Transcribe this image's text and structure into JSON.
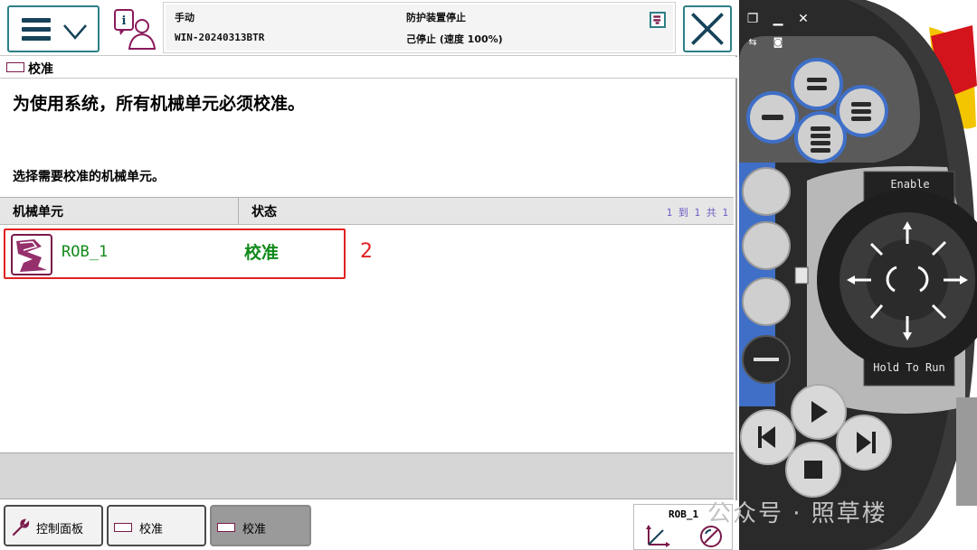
{
  "status": {
    "mode": "手动",
    "hostname": "WIN-20240313BTR",
    "guard_state": "防护装置停止",
    "run_state": "己停止 (速度 100%)"
  },
  "window": {
    "title": "校准"
  },
  "instruction": "为使用系统，所有机械单元必须校准。",
  "select_prompt": "选择需要校准的机械单元。",
  "table": {
    "columns": [
      "机械单元",
      "状态"
    ],
    "count_text": "1 到 1 共 1",
    "rows": [
      {
        "name": "ROB_1",
        "status": "校准"
      }
    ]
  },
  "annotation": "2",
  "taskbar": {
    "items": [
      "控制面板",
      "校准",
      "校准"
    ],
    "quickset_label": "ROB_1"
  },
  "pendant": {
    "enable_label": "Enable",
    "hold_label": "Hold To Run"
  },
  "watermark": "公众号 · 照草楼",
  "colors": {
    "accent": "#2d7f86",
    "ok_green": "#118a1a",
    "highlight_red": "#e12222",
    "pendant_blue": "#3f6fc7",
    "count_purple": "#6d5ac4"
  }
}
